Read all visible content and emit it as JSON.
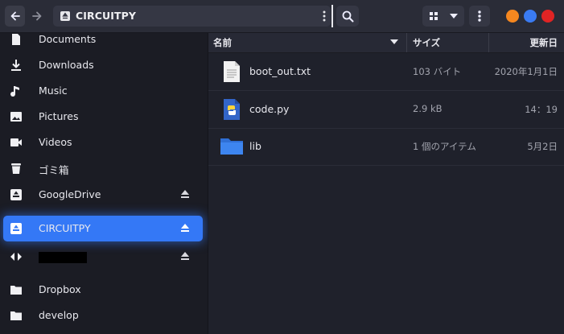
{
  "header": {
    "path_label": "CIRCUITPY",
    "window_dots": [
      {
        "name": "minimize",
        "color": "#f5871f"
      },
      {
        "name": "maximize",
        "color": "#3a7bf2"
      },
      {
        "name": "close",
        "color": "#e02424"
      }
    ]
  },
  "sidebar": {
    "items": [
      {
        "label": "Documents",
        "icon": "document-icon"
      },
      {
        "label": "Downloads",
        "icon": "download-icon"
      },
      {
        "label": "Music",
        "icon": "music-icon"
      },
      {
        "label": "Pictures",
        "icon": "picture-icon"
      },
      {
        "label": "Videos",
        "icon": "video-icon"
      },
      {
        "label": "ゴミ箱",
        "icon": "trash-icon"
      },
      {
        "label": "GoogleDrive",
        "icon": "drive-icon",
        "eject": true
      },
      {
        "label": "CIRCUITPY",
        "icon": "drive-icon",
        "eject": true,
        "active": true
      },
      {
        "label": "",
        "icon": "network-icon",
        "eject": true,
        "redacted": true
      },
      {
        "label": "Dropbox",
        "icon": "folder-icon"
      },
      {
        "label": "develop",
        "icon": "folder-icon"
      }
    ]
  },
  "columns": {
    "name": "名前",
    "size": "サイズ",
    "modified": "更新日"
  },
  "files": [
    {
      "name": "boot_out.txt",
      "size": "103 バイト",
      "modified": "2020年1月1日",
      "icon": "text-file-icon"
    },
    {
      "name": "code.py",
      "size": "2.9 kB",
      "modified": "14：19",
      "icon": "python-file-icon"
    },
    {
      "name": "lib",
      "size": "1 個のアイテム",
      "modified": "5月2日",
      "icon": "folder-icon"
    }
  ]
}
